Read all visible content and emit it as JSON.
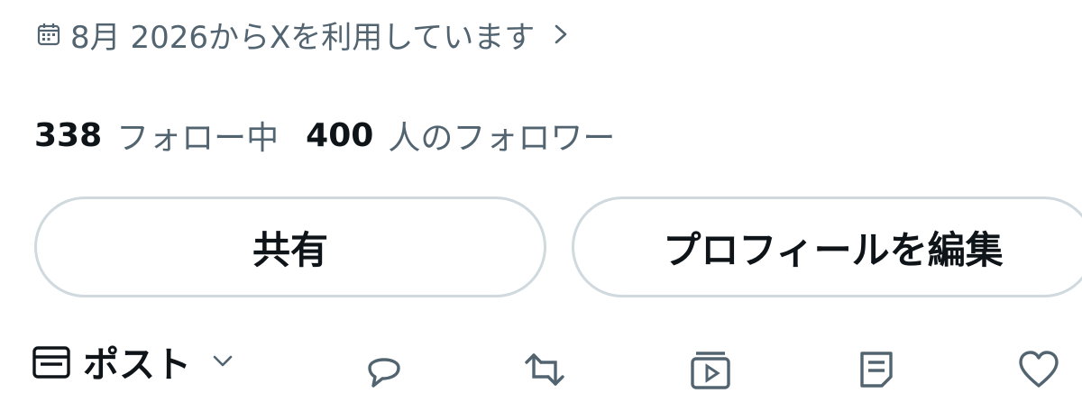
{
  "profile": {
    "joined_text": "8月 2026からXを利用しています",
    "following_count": "338",
    "following_label": "フォロー中",
    "followers_count": "400",
    "followers_label": "人のフォロワー"
  },
  "buttons": {
    "share_label": "共有",
    "edit_profile_label": "プロフィールを編集"
  },
  "tabs": {
    "posts_label": "ポスト"
  },
  "icons": {
    "joined": "calendar-icon",
    "joined_chevron": "chevron-right-icon",
    "posts_tab": "post-icon",
    "posts_chevron": "chevron-down-icon",
    "actions": [
      "reply-icon",
      "repost-icon",
      "media-icon",
      "article-icon",
      "like-icon"
    ]
  },
  "colors": {
    "text_primary": "#0f1419",
    "text_secondary": "#536471",
    "border": "#cfd9de",
    "background": "#ffffff"
  }
}
